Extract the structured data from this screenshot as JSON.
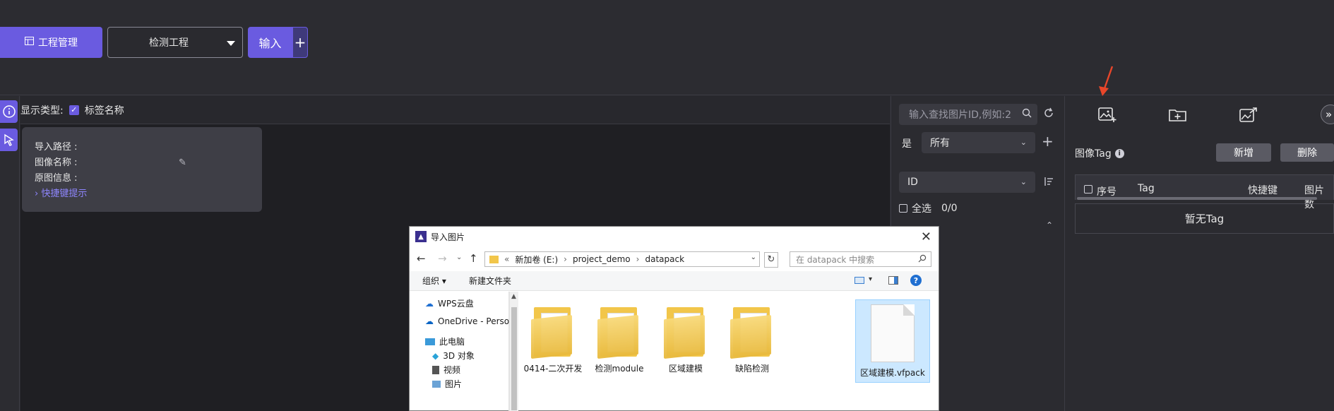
{
  "toolbar": {
    "project_btn": "工程管理",
    "project_select": "检测工程",
    "input_btn": "输入",
    "plus_btn": "+"
  },
  "canvas": {
    "display_type_label": "显示类型:",
    "tag_name_label": "标签名称",
    "info": {
      "import_path": "导入路径 :",
      "image_name": "图像名称 :",
      "origin_info": "原图信息 :",
      "shortcut_hint": "快捷键提示"
    }
  },
  "filter": {
    "search_placeholder": "输入查找图片ID,例如:2",
    "is_label": "是",
    "all_option": "所有",
    "sort_field": "ID",
    "select_all": "全选",
    "count": "0/0"
  },
  "tags": {
    "title": "图像Tag",
    "add_btn": "新增",
    "delete_btn": "删除",
    "col_index": "序号",
    "col_tag": "Tag",
    "col_shortcut": "快捷键",
    "col_count": "图片数",
    "empty": "暂无Tag"
  },
  "dialog": {
    "title": "导入图片",
    "path": [
      "新加卷 (E:)",
      "project_demo",
      "datapack"
    ],
    "search_placeholder": "在 datapack 中搜索",
    "organize": "组织",
    "new_folder": "新建文件夹",
    "nav": [
      "WPS云盘",
      "OneDrive - Perso",
      "此电脑",
      "3D 对象",
      "视频",
      "图片"
    ],
    "files": [
      "0414-二次开发",
      "检测module",
      "区域建模",
      "缺陷检测",
      "区域建模.vfpack"
    ]
  },
  "colors": {
    "accent": "#6a5be0",
    "annotation_arrow": "#e8462a"
  }
}
